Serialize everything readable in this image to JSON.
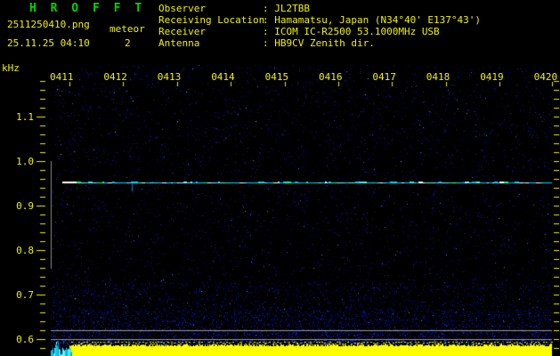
{
  "header": {
    "title": "H R O F F T",
    "filename": "2511250410.png",
    "mode": "meteor",
    "datetime": "25.11.25 04:10",
    "count": "2",
    "fields": [
      {
        "label": "Observer",
        "value": "JL2TBB"
      },
      {
        "label": "Receiving Location",
        "value": "Hamamatsu, Japan (N34°40' E137°43')"
      },
      {
        "label": "Receiver",
        "value": "ICOM IC-R2500 53.1000MHz USB"
      },
      {
        "label": "Antenna",
        "value": "HB9CV Zenith dir."
      }
    ]
  },
  "chart_data": {
    "type": "heatmap",
    "title": "HROFFT 10-minute radio meteor spectrogram",
    "ylabel": "kHz",
    "x_tick_labels": [
      "0411",
      "0412",
      "0413",
      "0414",
      "0415",
      "0416",
      "0417",
      "0418",
      "0419",
      "0420"
    ],
    "y_tick_labels": [
      "1.1",
      "1.0",
      "0.9",
      "0.8",
      "0.7",
      "0.6"
    ],
    "y_range_khz": [
      0.56,
      1.22
    ],
    "x_range_time": [
      "04:10",
      "04:20"
    ],
    "grid": false,
    "features": {
      "carrier_line_khz": 0.95,
      "carrier_line_extent": "continuous horizontal cyan line across full 10 minutes",
      "reference_lines_khz": [
        0.62,
        0.6
      ],
      "detection_window_marker_khz": [
        0.76,
        1.0
      ],
      "signal_level_bar": "saturated full-width yellow bar along bottom edge",
      "meteor_count": 2
    }
  },
  "colors": {
    "background": "#000000",
    "title_green": "#00d400",
    "text_yellow": "#f0f000",
    "axis_yellow": "#f0f000",
    "noise_blue": "#16169c",
    "carrier_cyan": "#00d5ff",
    "reference_gray": "#9a9a9a",
    "level_bar_yellow": "#ffff00"
  }
}
